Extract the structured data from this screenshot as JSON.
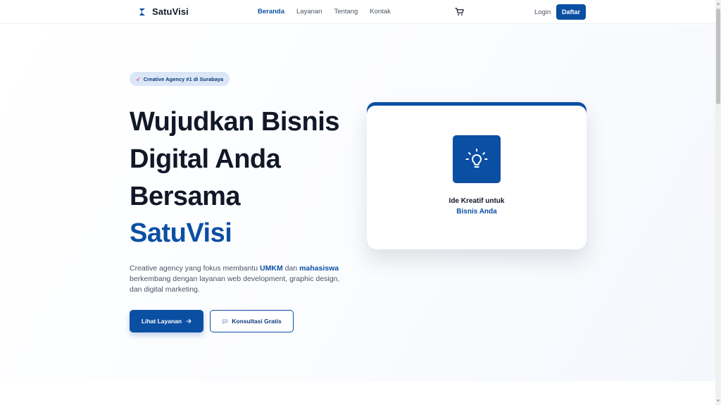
{
  "brand": {
    "name": "SatuVisi"
  },
  "nav": {
    "links": [
      {
        "label": "Beranda",
        "active": true
      },
      {
        "label": "Layanan",
        "active": false
      },
      {
        "label": "Tentang",
        "active": false
      },
      {
        "label": "Kontak",
        "active": false
      }
    ],
    "login_label": "Login",
    "register_label": "Daftar"
  },
  "hero": {
    "badge": "Creative Agency #1 di Surabaya",
    "headline_lines": [
      "Wujudkan Bisnis",
      "Digital Anda",
      "Bersama"
    ],
    "accent": "SatuVisi",
    "description": {
      "part1": "Creative agency yang fokus membantu ",
      "highlight1": "UMKM",
      "part2": " dan ",
      "highlight2": "mahasiswa",
      "part3": " berkembang dengan layanan web development, graphic design, dan digital marketing."
    },
    "primary_button": "Lihat Layanan",
    "secondary_button": "Konsultasi Gratis"
  },
  "card": {
    "line1": "Ide Kreatif untuk",
    "line2": "Bisnis Anda"
  },
  "colors": {
    "primary": "#0b4fa3",
    "badge_bg": "#dbe6f7",
    "text_dark": "#111827",
    "text_muted": "#4b5563"
  },
  "icons": {
    "brand": "brand-logo-icon",
    "cart": "cart-icon",
    "badge": "rocket-icon",
    "arrow": "arrow-right-icon",
    "chat": "chat-icon",
    "lightbulb": "lightbulb-icon"
  }
}
